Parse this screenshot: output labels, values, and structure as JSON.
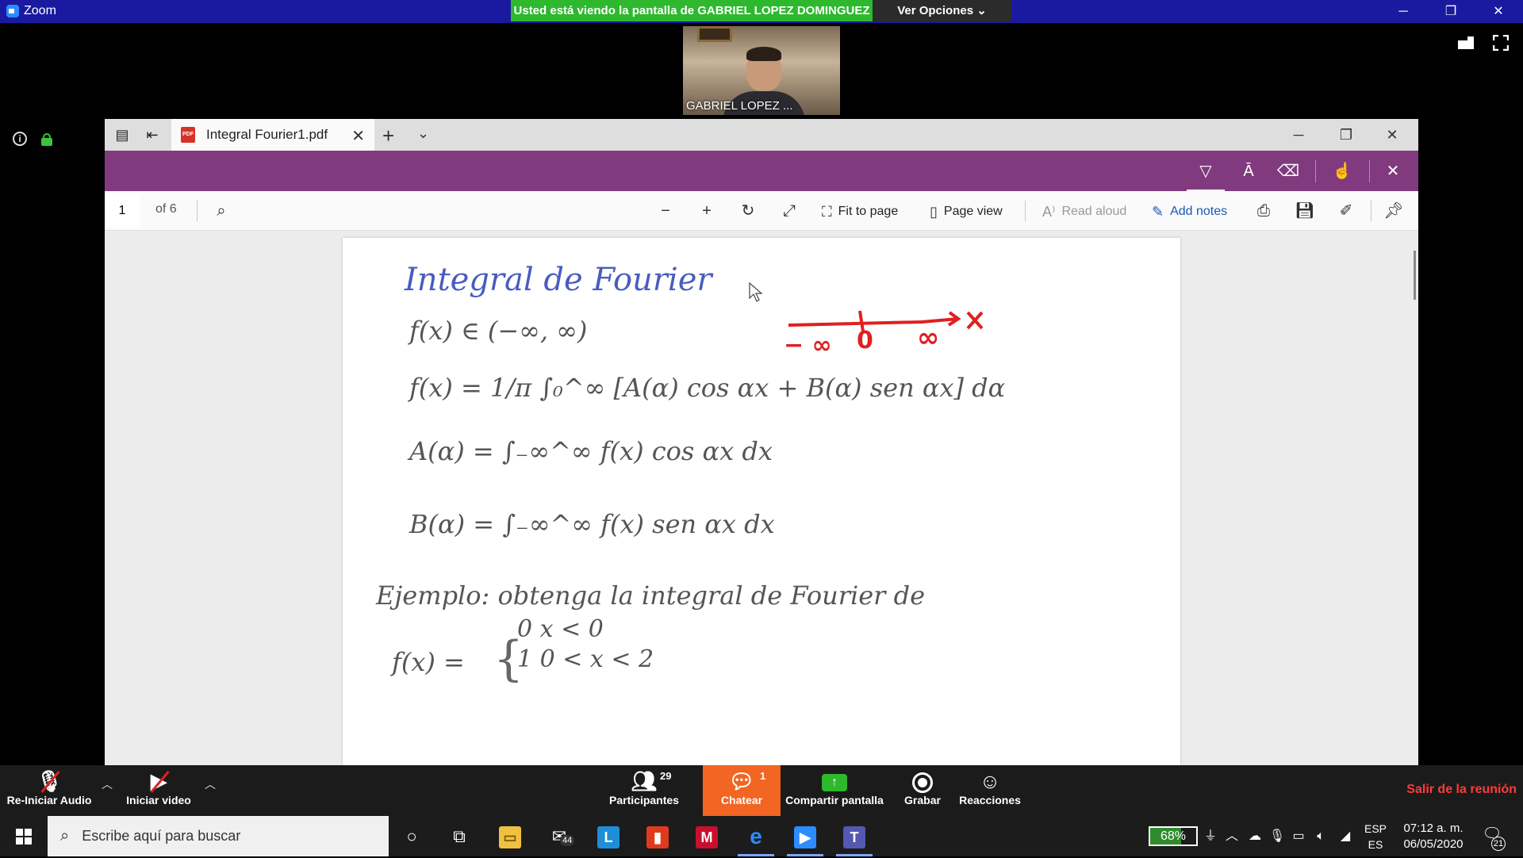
{
  "zoom": {
    "app_title": "Zoom",
    "share_banner": "Usted está viendo la pantalla de GABRIEL LOPEZ DOMINGUEZ",
    "view_options": "Ver Opciones ⌄",
    "participant_name": "GABRIEL LOPEZ ...",
    "controls": {
      "audio": "Re-Iniciar Audio",
      "video": "Iniciar video",
      "participants": "Participantes",
      "participants_count": "29",
      "chat": "Chatear",
      "chat_count": "1",
      "share": "Compartir pantalla",
      "record": "Grabar",
      "reactions": "Reacciones",
      "leave": "Salir de la reunión"
    }
  },
  "edge": {
    "tab_title": "Integral Fourier1.pdf",
    "page_number": "1",
    "page_of": "of 6",
    "fit_to_page": "Fit to page",
    "page_view": "Page view",
    "read_aloud": "Read aloud",
    "add_notes": "Add notes",
    "ink_color": "#813a7e"
  },
  "document": {
    "title": "Integral de Fourier",
    "line1": "f(x)  ∈  (−∞, ∞)",
    "line2": "f(x) = 1/π ∫₀^∞ [A(α) cos αx + B(α) sen αx] dα",
    "line3": "A(α) = ∫₋∞^∞ f(x) cos αx dx",
    "line4": "B(α) = ∫₋∞^∞ f(x) sen αx dx",
    "example": "Ejemplo: obtenga la integral de Fourier de",
    "piece_lhs": "f(x) =",
    "piece1": "0      x < 0",
    "piece2": "1      0 < x < 2",
    "axis_neg": "− ∞",
    "axis_zero": "0",
    "axis_pos": "∞",
    "axis_var": "x"
  },
  "taskbar": {
    "search_placeholder": "Escribe aquí para buscar",
    "mail_badge": "44",
    "battery": "68%",
    "lang1": "ESP",
    "lang2": "ES",
    "time": "07:12 a. m.",
    "date": "06/05/2020",
    "notifications": "21"
  }
}
